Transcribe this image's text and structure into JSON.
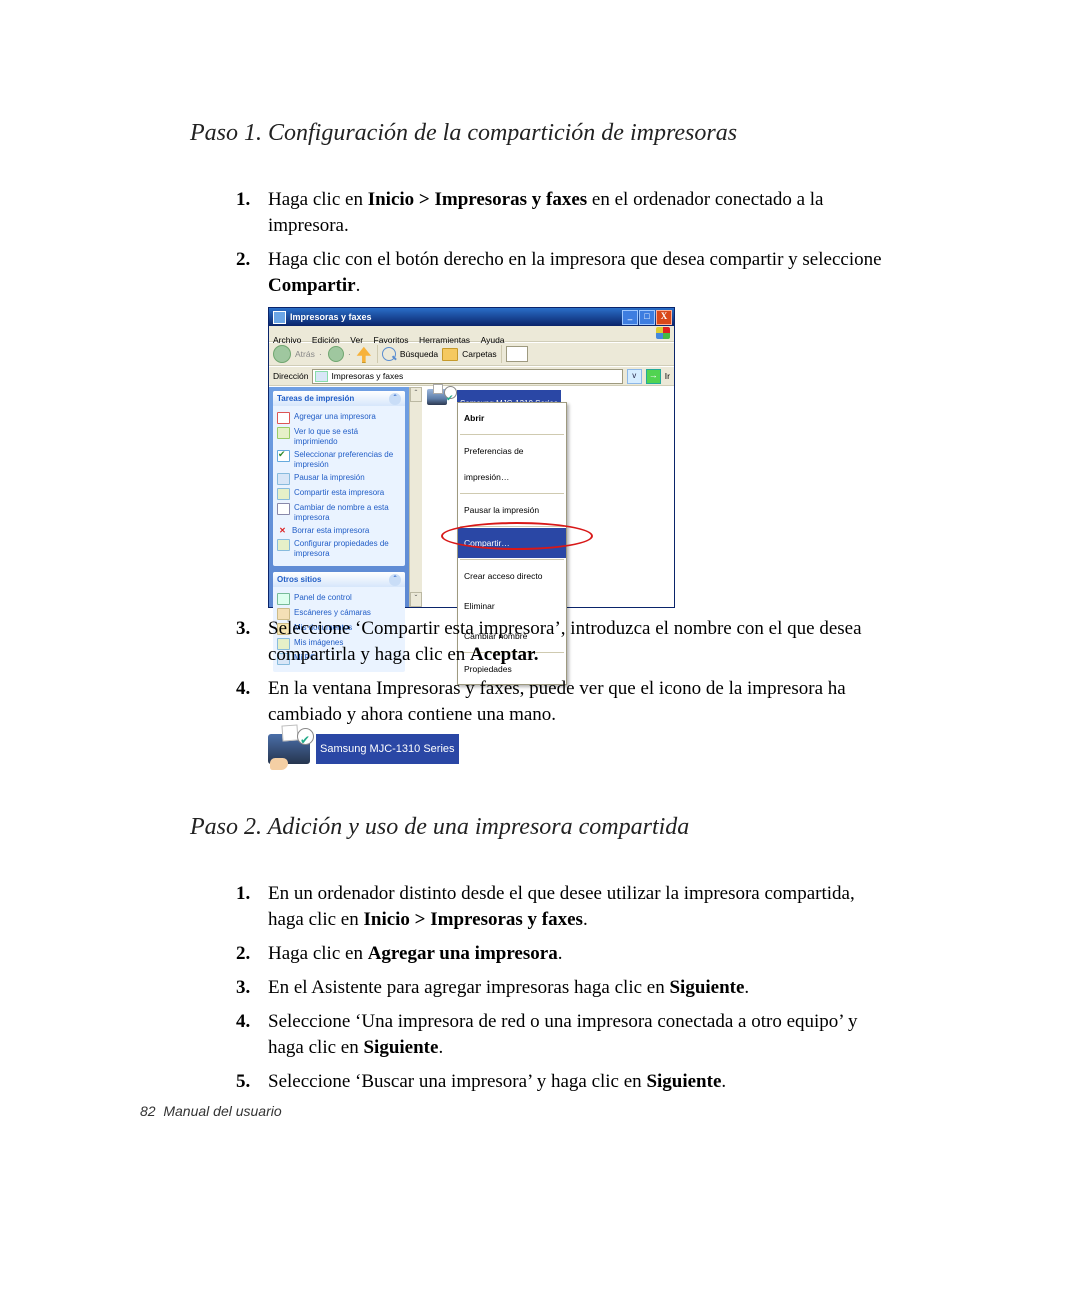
{
  "section1": {
    "title": "Paso 1. Configuración de la compartición de impresoras",
    "items": {
      "1": {
        "pre": "Haga clic en ",
        "bold": "Inicio > Impresoras y faxes",
        "post": " en el ordenador conectado a la impresora."
      },
      "2": {
        "pre": "Haga clic con el botón derecho en la impresora que desea compartir y seleccione ",
        "bold": "Compartir",
        "post": "."
      },
      "3": {
        "pre": "Seleccione ‘Compartir esta impresora’, introduzca el nombre con el que desea compartirla y haga clic en ",
        "bold": "Aceptar.",
        "post": ""
      },
      "4": {
        "text": "En la ventana Impresoras y faxes, puede ver que el icono de la impresora ha cambiado y ahora contiene una mano."
      }
    }
  },
  "section2": {
    "title": "Paso 2. Adición y uso de una impresora compartida",
    "items": {
      "1": {
        "pre": "En un ordenador distinto desde el que desee utilizar la impresora compartida, haga clic en ",
        "bold": "Inicio > Impresoras y faxes",
        "post": "."
      },
      "2": {
        "pre": "Haga clic en ",
        "bold": "Agregar una impresora",
        "post": "."
      },
      "3": {
        "pre": "En el Asistente para agregar impresoras haga clic en ",
        "bold": "Siguiente",
        "post": "."
      },
      "4": {
        "pre": "Seleccione ‘Una impresora de red o una impresora conectada a otro equipo’ y haga clic en ",
        "bold": "Siguiente",
        "post": "."
      },
      "5": {
        "pre": "Seleccione ‘Buscar una impresora’ y haga clic en ",
        "bold": "Siguiente",
        "post": "."
      }
    }
  },
  "xp": {
    "title": "Impresoras y faxes",
    "menus": {
      "archivo": "Archivo",
      "edicion": "Edición",
      "ver": "Ver",
      "favoritos": "Favoritos",
      "herramientas": "Herramientas",
      "ayuda": "Ayuda"
    },
    "toolbar": {
      "atras": "Atrás",
      "busqueda": "Búsqueda",
      "carpetas": "Carpetas"
    },
    "address": {
      "label": "Dirección",
      "value": "Impresoras y faxes",
      "go": "Ir"
    },
    "side": {
      "panel1": {
        "title": "Tareas de impresión",
        "items": {
          "add": "Agregar una impresora",
          "see": "Ver lo que se está imprimiendo",
          "prefs1": "Seleccionar preferencias de",
          "prefs2": "impresión",
          "pause": "Pausar la impresión",
          "share": "Compartir esta impresora",
          "rename1": "Cambiar de nombre a esta",
          "rename2": "impresora",
          "delete": "Borrar esta impresora",
          "props1": "Configurar propiedades de",
          "props2": "impresora"
        }
      },
      "panel2": {
        "title": "Otros sitios",
        "items": {
          "cp": "Panel de control",
          "cam": "Escáneres y cámaras",
          "docs": "Mis documentos",
          "pics": "Mis imágenes",
          "pc": "Mi PC"
        }
      }
    },
    "printer_label": "Samsung MJC-1310 Series",
    "ctx": {
      "abrir": "Abrir",
      "pref": "Preferencias de impresión…",
      "pausar": "Pausar la impresión",
      "compartir": "Compartir…",
      "acceso": "Crear acceso directo",
      "eliminar": "Eliminar",
      "cambiar": "Cambiar nombre",
      "prop": "Propiedades"
    },
    "btns": {
      "min": "_",
      "max": "□",
      "close": "X"
    }
  },
  "mini_printer_label": "Samsung MJC-1310 Series",
  "footer": {
    "page": "82",
    "label": "Manual del usuario"
  },
  "numbers": {
    "n1": "1.",
    "n2": "2.",
    "n3": "3.",
    "n4": "4.",
    "n5": "5."
  },
  "glyphs": {
    "chev_up": "ˆ",
    "chev_dn": "ˇ",
    "dd": "v",
    "go": "→",
    "x": "✕"
  }
}
